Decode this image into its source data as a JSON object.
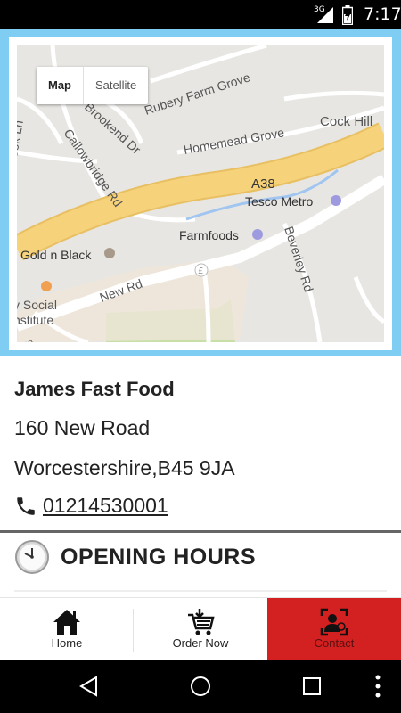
{
  "status_bar": {
    "network": "3G",
    "time": "7:17"
  },
  "map": {
    "toggle": {
      "map_label": "Map",
      "satellite_label": "Satellite",
      "selected": "Map"
    },
    "labels": {
      "rubery_farm_grove": "Rubery Farm Grove",
      "cock_hill": "Cock Hill",
      "homemead_grove": "Homemead Grove",
      "brookend_dr": "Brookend Dr",
      "callowbridge_rd": "Callowbridge Rd",
      "allowbrook_ln": "allowbrook Ln",
      "a38": "A38",
      "tesco_metro": "Tesco Metro",
      "farmfoods": "Farmfoods",
      "beverley_rd": "Beverley Rd",
      "gold_n_black": "Gold n Black",
      "new_rd": "New Rd",
      "social": "y Social",
      "institute": "nstitute",
      "st": "St"
    }
  },
  "business": {
    "name": "James Fast Food",
    "address_line1": "160 New Road",
    "address_line2": "Worcestershire,B45 9JA",
    "phone": "01214530001"
  },
  "opening_hours": {
    "title": "OPENING HOURS"
  },
  "bottom_nav": {
    "home": "Home",
    "order_now": "Order Now",
    "contact": "Contact"
  },
  "colors": {
    "map_frame": "#7fcdf2",
    "contact_active": "#d32020",
    "highway": "#f6d27a"
  }
}
